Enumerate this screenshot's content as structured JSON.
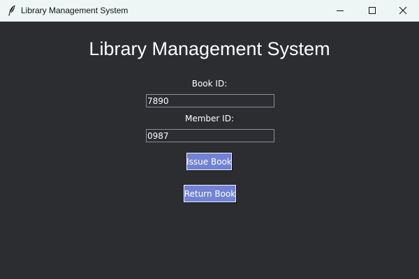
{
  "window": {
    "title": "Library Management System",
    "icon": "feather-icon",
    "controls": [
      "minimize-icon",
      "maximize-icon",
      "close-icon"
    ]
  },
  "main": {
    "heading": "Library Management System",
    "book_id": {
      "label": "Book ID:",
      "value": "7890"
    },
    "member_id": {
      "label": "Member ID:",
      "value": "0987"
    },
    "issue_button": "Issue Book",
    "return_button": "Return Book"
  },
  "colors": {
    "background": "#2b2d31",
    "titlebar": "#eef6f5",
    "button": "#7282d4",
    "text": "#ffffff"
  }
}
